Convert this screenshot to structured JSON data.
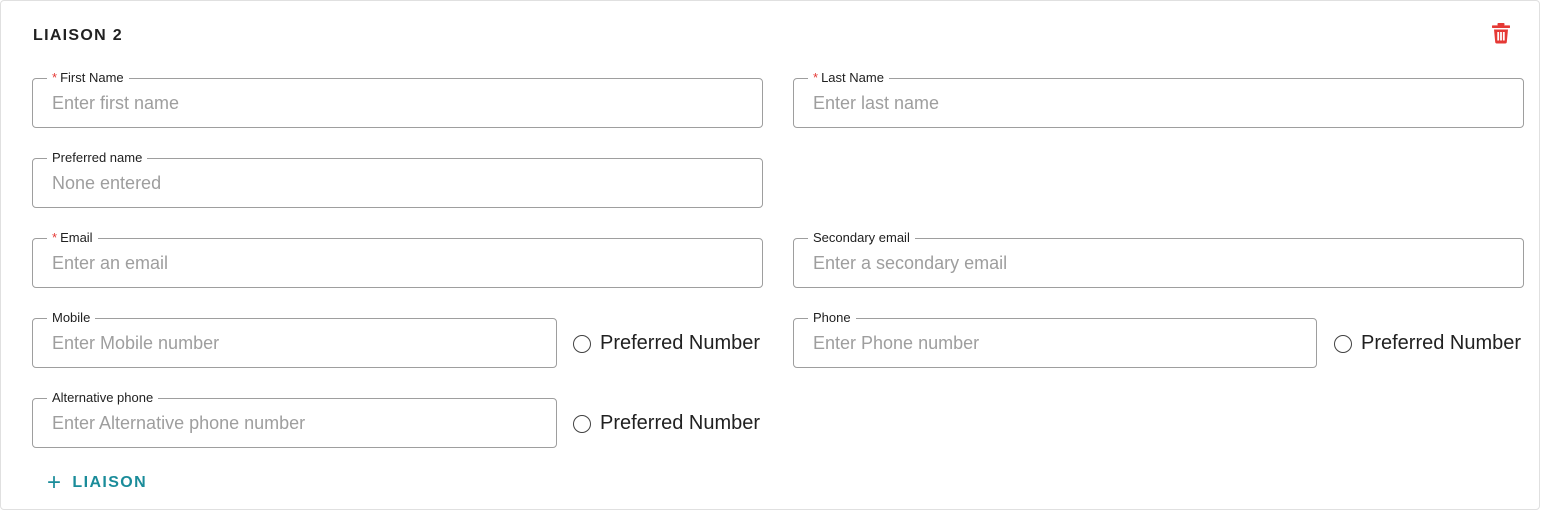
{
  "section": {
    "title": "LIAISON 2"
  },
  "fields": {
    "first_name": {
      "label": "First Name",
      "required_mark": "*",
      "placeholder": "Enter first name",
      "value": ""
    },
    "last_name": {
      "label": "Last Name",
      "required_mark": "*",
      "placeholder": "Enter last name",
      "value": ""
    },
    "preferred_name": {
      "label": "Preferred name",
      "placeholder": "None entered",
      "value": ""
    },
    "email": {
      "label": "Email",
      "required_mark": "*",
      "placeholder": "Enter an email",
      "value": ""
    },
    "secondary_email": {
      "label": "Secondary email",
      "placeholder": "Enter a secondary email",
      "value": ""
    },
    "mobile": {
      "label": "Mobile",
      "placeholder": "Enter Mobile number",
      "value": ""
    },
    "phone": {
      "label": "Phone",
      "placeholder": "Enter Phone number",
      "value": ""
    },
    "alternative_phone": {
      "label": "Alternative phone",
      "placeholder": "Enter Alternative phone number",
      "value": ""
    }
  },
  "preferred": {
    "mobile_label": "Preferred Number",
    "phone_label": "Preferred Number",
    "alternative_label": "Preferred Number"
  },
  "actions": {
    "add_plus": "+",
    "add_label": "LIAISON"
  },
  "icons": {
    "delete": "trash-icon",
    "radio": "radio-unchecked-icon"
  },
  "colors": {
    "required": "#e53935",
    "delete": "#e53935",
    "accent": "#1a8c9a",
    "border": "#9e9e9e",
    "placeholder": "#9e9e9e"
  }
}
